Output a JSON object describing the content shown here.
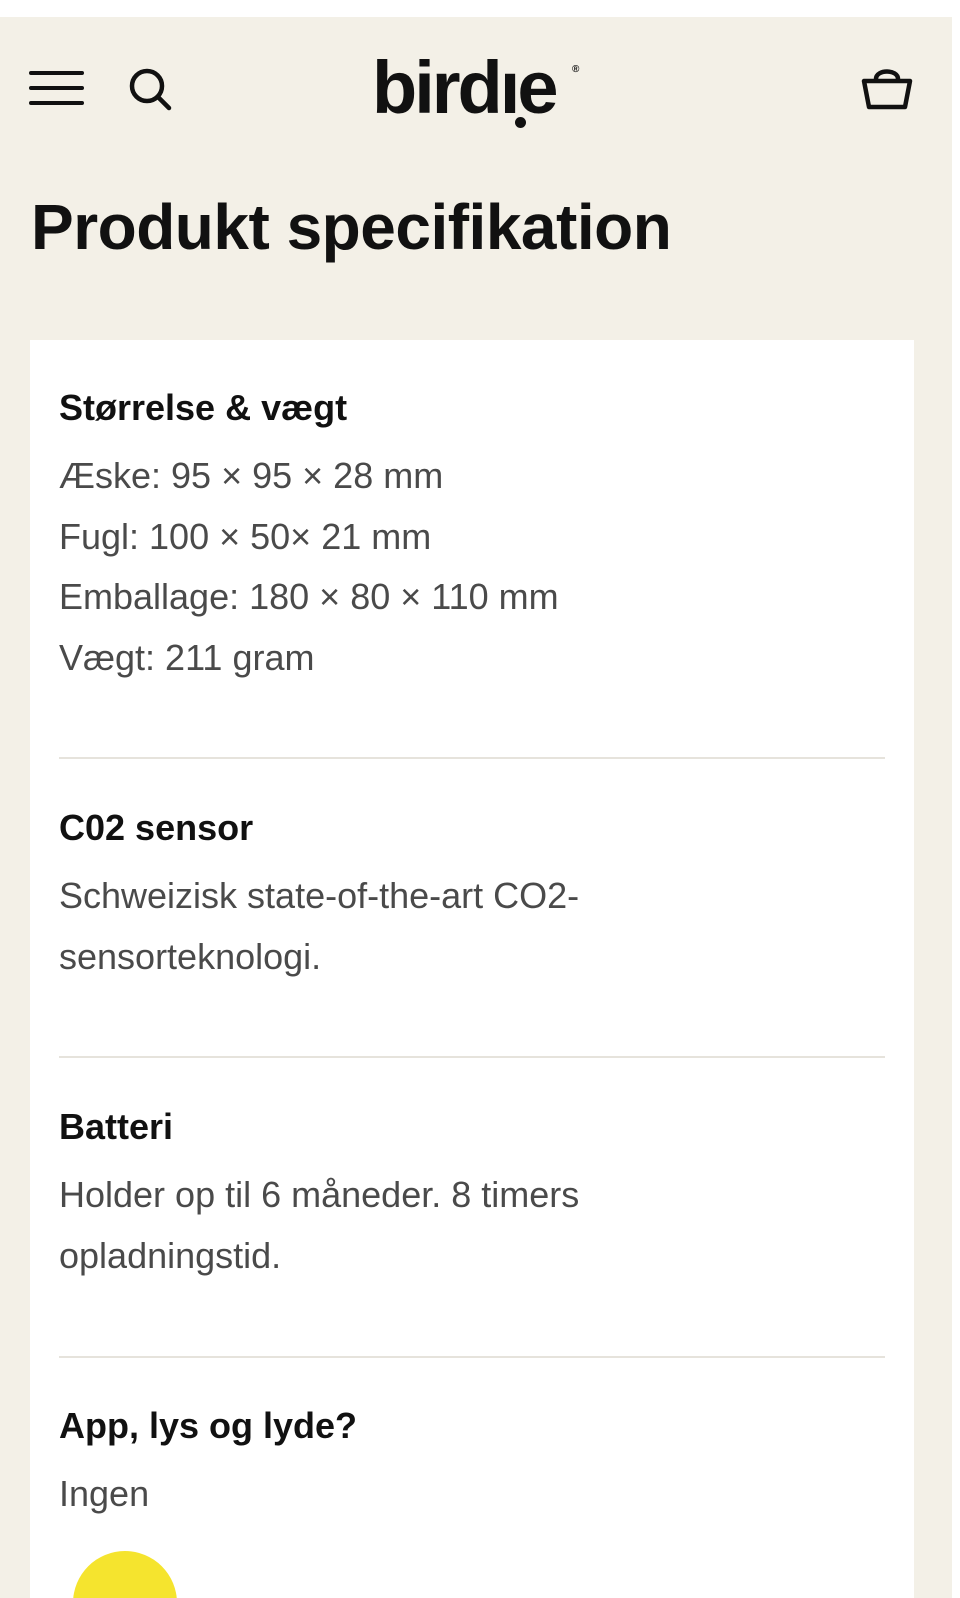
{
  "header": {
    "logo_text": "birdıe",
    "logo_registered": "®",
    "menu_icon": "hamburger-menu-icon",
    "search_icon": "search-icon",
    "cart_icon": "basket-icon"
  },
  "page": {
    "title": "Produkt specifikation"
  },
  "specs": [
    {
      "heading": "Størrelse & vægt",
      "lines": [
        "Æske: 95 × 95 × 28 mm",
        "Fugl: 100 × 50× 21 mm",
        "Emballage: 180 × 80 × 110 mm",
        "Vægt: 211 gram"
      ]
    },
    {
      "heading": "C02 sensor",
      "lines": [
        "Schweizisk state-of-the-art CO2-",
        "sensorteknologi."
      ]
    },
    {
      "heading": "Batteri",
      "lines": [
        "Holder op til 6 måneder. 8 timers",
        "opladningstid."
      ]
    },
    {
      "heading": "App, lys og lyde?",
      "lines": [
        "Ingen"
      ]
    }
  ],
  "colors": {
    "page_background": "#f3f0e7",
    "card_background": "#ffffff",
    "heading_text": "#111111",
    "body_text": "#4a4a4a",
    "divider": "#e6e3dc",
    "accent_yellow": "#f5e42e"
  }
}
